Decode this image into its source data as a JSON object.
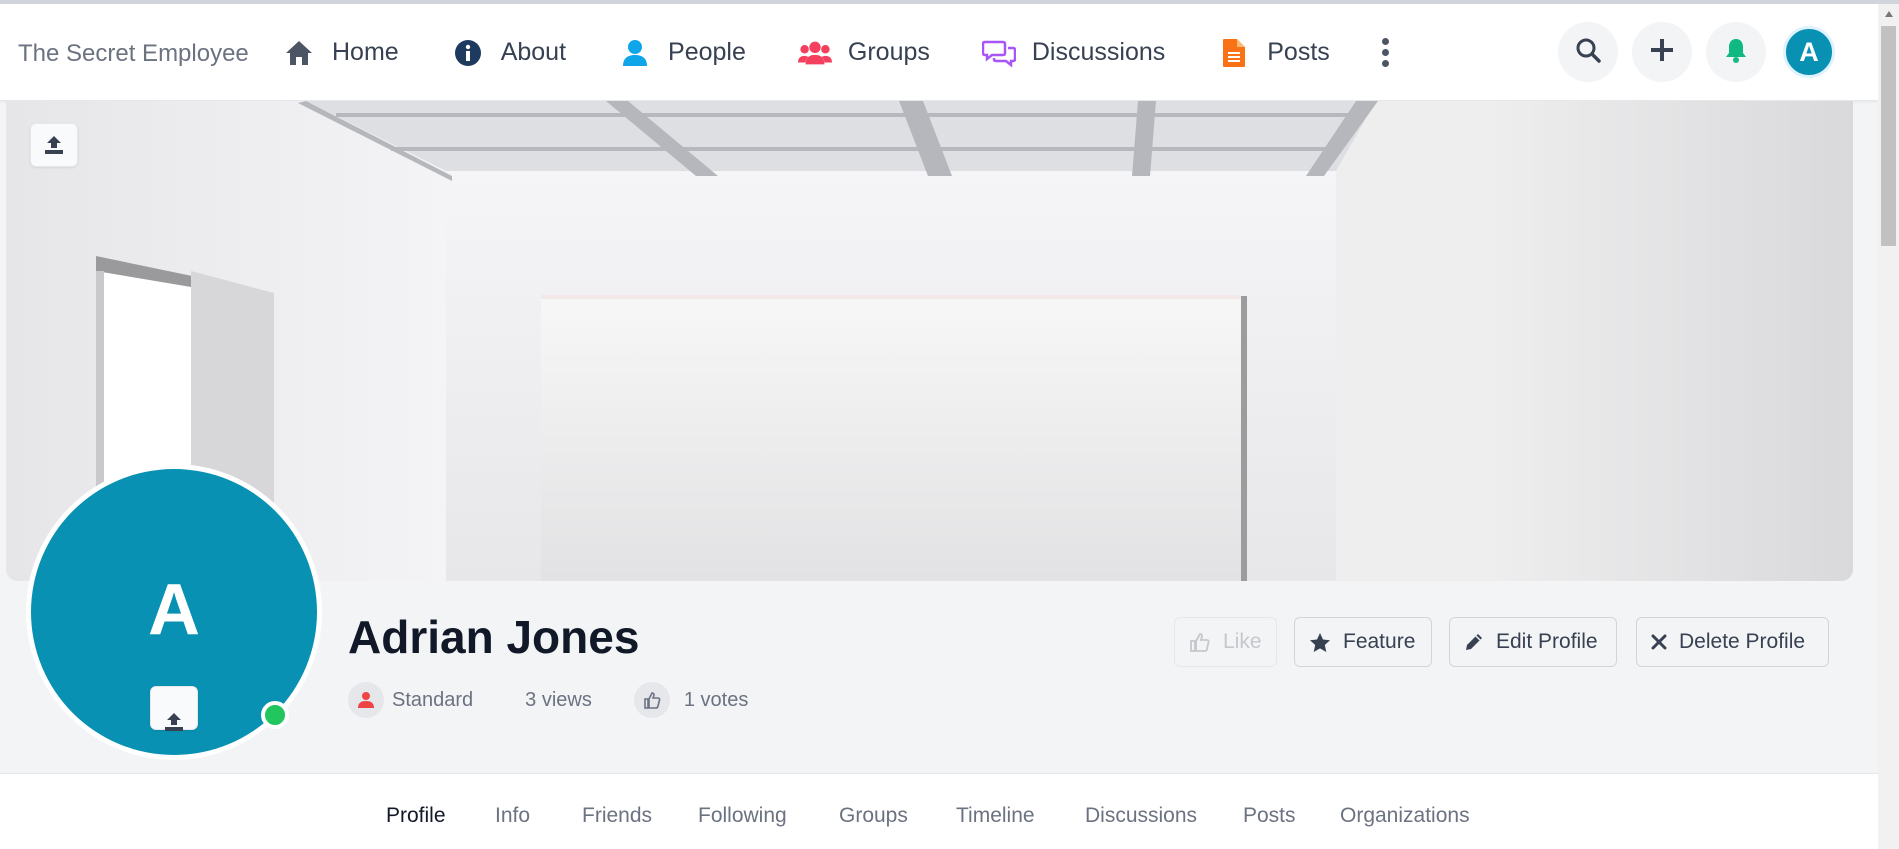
{
  "brand": "The Secret Employee",
  "nav": {
    "items": [
      {
        "label": "Home",
        "icon": "home-icon",
        "color": "#4b5563"
      },
      {
        "label": "About",
        "icon": "info-circle-icon",
        "color": "#1e3a5f"
      },
      {
        "label": "People",
        "icon": "user-icon",
        "color": "#0ea5e9"
      },
      {
        "label": "Groups",
        "icon": "users-icon",
        "color": "#f43f5e"
      },
      {
        "label": "Discussions",
        "icon": "comments-icon",
        "color": "#a855f7"
      },
      {
        "label": "Posts",
        "icon": "file-icon",
        "color": "#f97316"
      }
    ],
    "avatar_letter": "A"
  },
  "profile": {
    "avatar_letter": "A",
    "name": "Adrian Jones",
    "role": "Standard",
    "views": "3 views",
    "votes": "1 votes"
  },
  "actions": {
    "like": "Like",
    "feature": "Feature",
    "edit": "Edit Profile",
    "delete": "Delete Profile"
  },
  "tabs": [
    "Profile",
    "Info",
    "Friends",
    "Following",
    "Groups",
    "Timeline",
    "Discussions",
    "Posts",
    "Organizations"
  ],
  "colors": {
    "accent": "#0891b2",
    "online": "#22c55e",
    "notify": "#10b981"
  }
}
